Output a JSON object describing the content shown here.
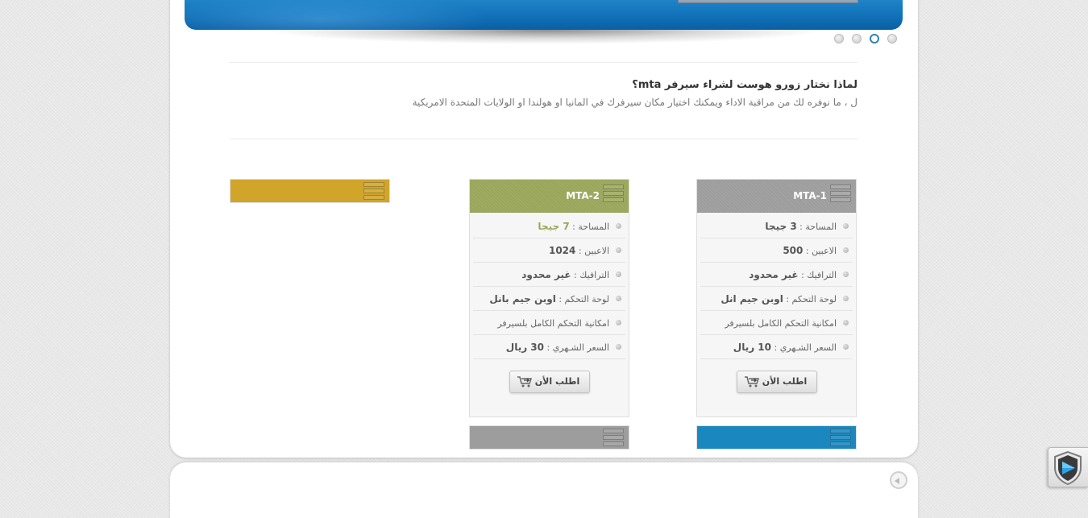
{
  "why": {
    "title": "لماذا نختار زورو هوست لشراء سيرفر mta؟",
    "text": "ل ، ما نوفره لك من مراقبة الاداء ويمكنك اختيار مكان سيرفرك في المانيا او هولندا او الولايات المتحدة الامريكية"
  },
  "plans": [
    {
      "name": "MTA-1",
      "color": "#9d9d9d",
      "features": [
        {
          "label": "المساحة : ",
          "value": "3 جيجا"
        },
        {
          "label": "الاعبين : ",
          "value": "500"
        },
        {
          "label": "الترافيك : ",
          "value": "غير محدود"
        },
        {
          "label": "لوحة التحكم : ",
          "value": "اوبن جيم انل"
        },
        {
          "label": "امكانية التحكم الكامل بلسيرفر",
          "value": ""
        },
        {
          "label": "السعر الشـهري : ",
          "value": "10 ريال"
        }
      ],
      "order_label": "اطلب الأن"
    },
    {
      "name": "MTA-2",
      "color": "#9aa65a",
      "features": [
        {
          "label": "المساحة : ",
          "value": "7 جيجا"
        },
        {
          "label": "الاعبين : ",
          "value": "1024"
        },
        {
          "label": "الترافيك : ",
          "value": "غير محدود"
        },
        {
          "label": "لوحة التحكم : ",
          "value": "اوبن جيم بانل"
        },
        {
          "label": "امكانية التحكم الكامل بلسيرفر",
          "value": ""
        },
        {
          "label": "السعر الشـهري : ",
          "value": "30 ريال"
        }
      ],
      "order_label": "اطلب الأن"
    }
  ],
  "colors": {
    "gold": "#d1a42a",
    "blue": "#1b87bf",
    "gray": "#9d9d9d",
    "accent": "#2f83b5"
  },
  "icons": {
    "slider_dots": "dot",
    "feature_bullet": "bullet-icon",
    "cart": "cart-icon",
    "server": "server-icon",
    "scroll_up": "arrow-left-icon",
    "shield": "shield-icon"
  }
}
